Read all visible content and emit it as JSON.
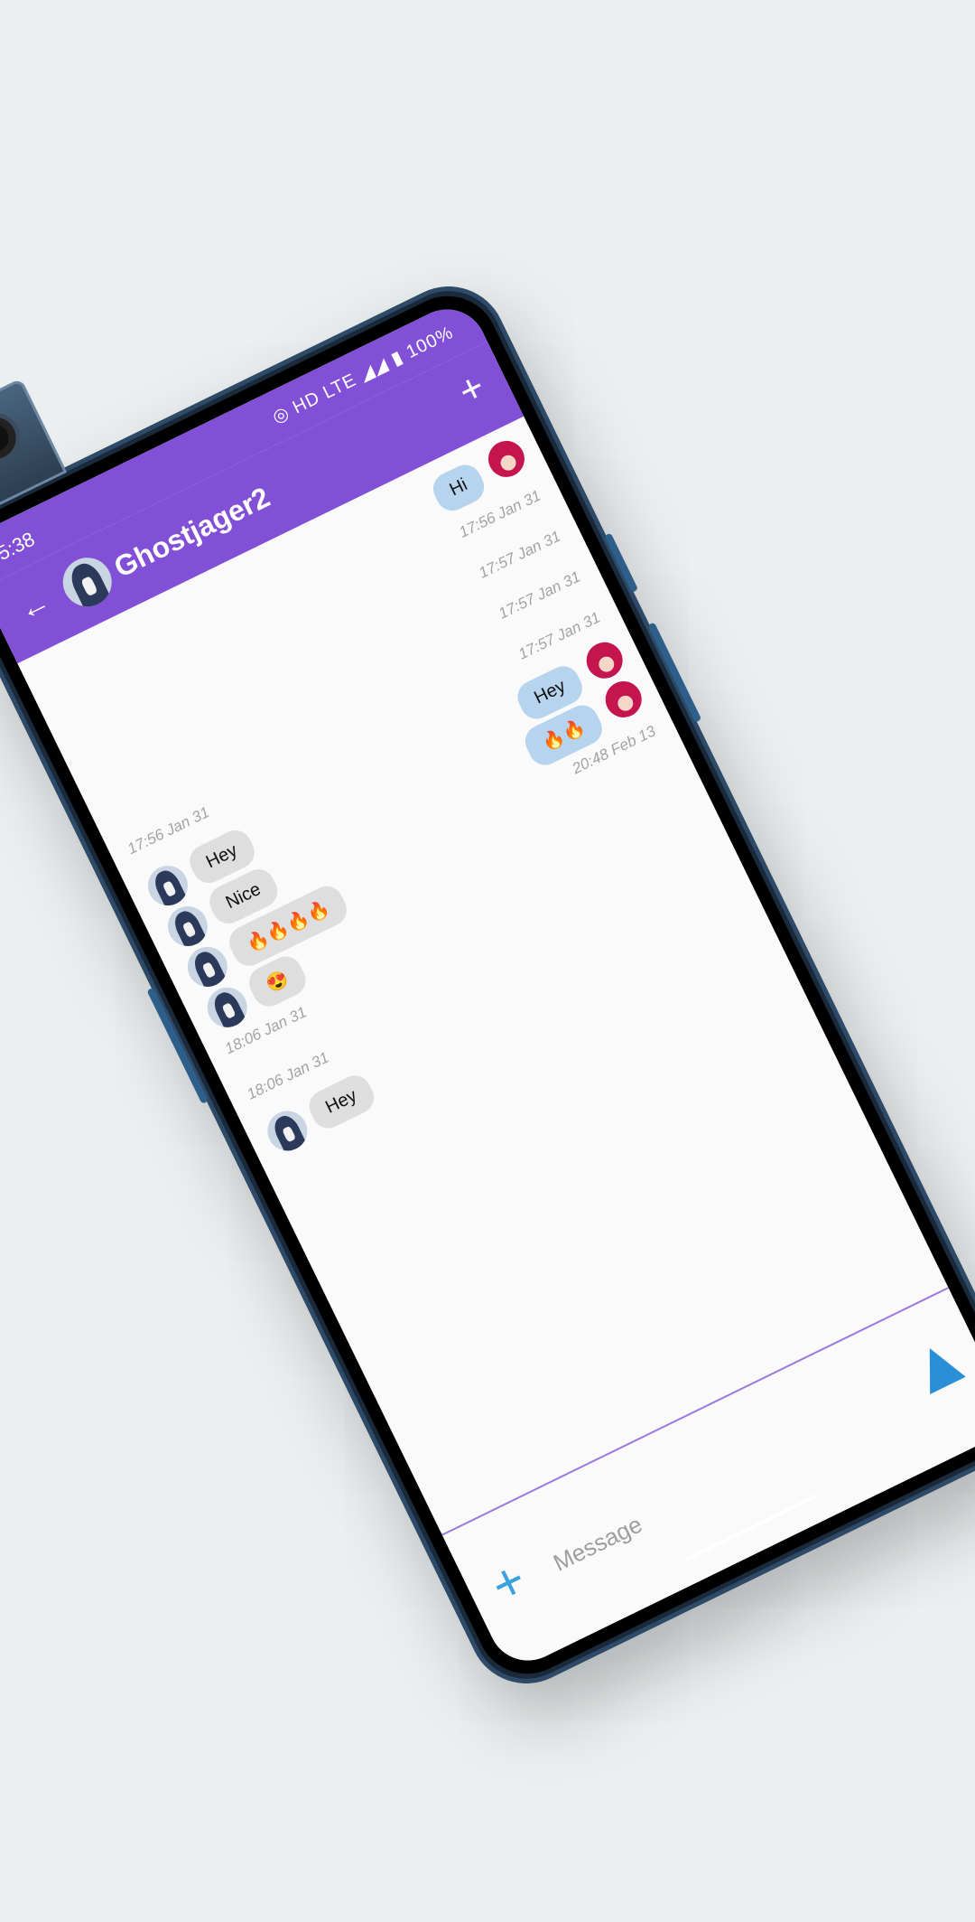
{
  "status_bar": {
    "time": "5:38",
    "indicators": "HD LTE",
    "battery": "100%"
  },
  "app_bar": {
    "title": "Ghostjager2"
  },
  "messages": [
    {
      "side": "out",
      "text": "Hi"
    },
    {
      "side": "ts_right",
      "text": "17:56 Jan 31"
    },
    {
      "side": "ts_right",
      "text": "17:57 Jan 31"
    },
    {
      "side": "ts_right",
      "text": "17:57 Jan 31"
    },
    {
      "side": "ts_right",
      "text": "17:57 Jan 31"
    },
    {
      "side": "out",
      "text": "Hey"
    },
    {
      "side": "out",
      "text": "🔥🔥"
    },
    {
      "side": "ts_right",
      "text": "20:48 Feb 13"
    },
    {
      "side": "ts_left",
      "text": "17:56 Jan 31"
    },
    {
      "side": "in",
      "text": "Hey"
    },
    {
      "side": "in",
      "text": "Nice"
    },
    {
      "side": "in",
      "text": "🔥🔥🔥🔥"
    },
    {
      "side": "in",
      "text": "😍"
    },
    {
      "side": "ts_left",
      "text": "18:06 Jan 31"
    },
    {
      "side": "ts_left",
      "text": "18:06 Jan 31"
    },
    {
      "side": "in",
      "text": "Hey"
    }
  ],
  "composer": {
    "placeholder": "Message"
  },
  "colors": {
    "accent": "#8250d6",
    "outgoing_bubble": "#b6d4ee",
    "incoming_bubble": "#dedede",
    "send": "#2a8fd6"
  }
}
